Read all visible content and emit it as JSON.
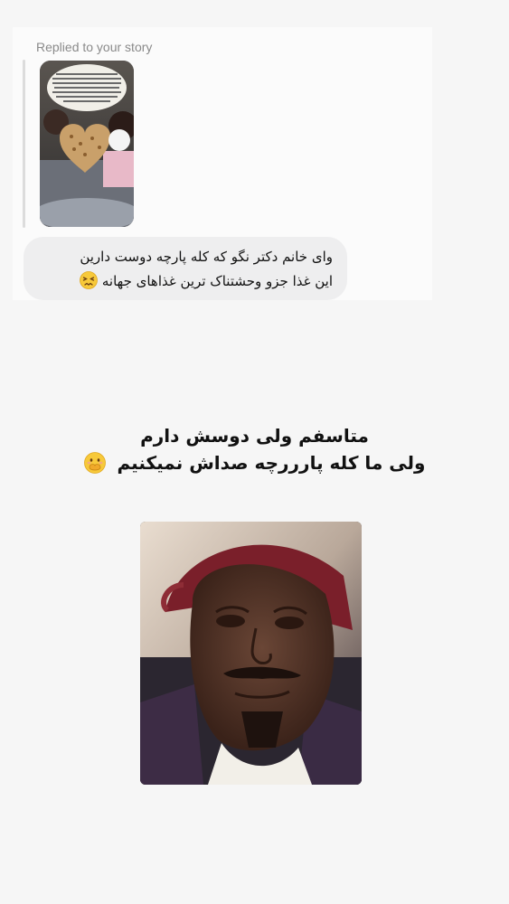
{
  "story_reply": {
    "label": "Replied to your story"
  },
  "message": {
    "line1": "وای خانم دکتر نگو که کله پارچه دوست دارین",
    "line2": "این غذا جزو وحشتناک ترین غذاهای جهانه",
    "emoji": "persevering-face-emoji"
  },
  "caption": {
    "line1": "متاسفم ولی دوسش دارم",
    "line2": "ولی ما کله پارررچه صداش نمیکنیم",
    "emoji": "face-with-hand-over-mouth-emoji"
  },
  "images": {
    "story_thumbnail": "story-photo-food",
    "meme": "crying-man-photo"
  },
  "colors": {
    "background": "#f6f6f6",
    "bubble": "#eeeeef",
    "label_gray": "#8a8a8a",
    "text": "#111111"
  }
}
